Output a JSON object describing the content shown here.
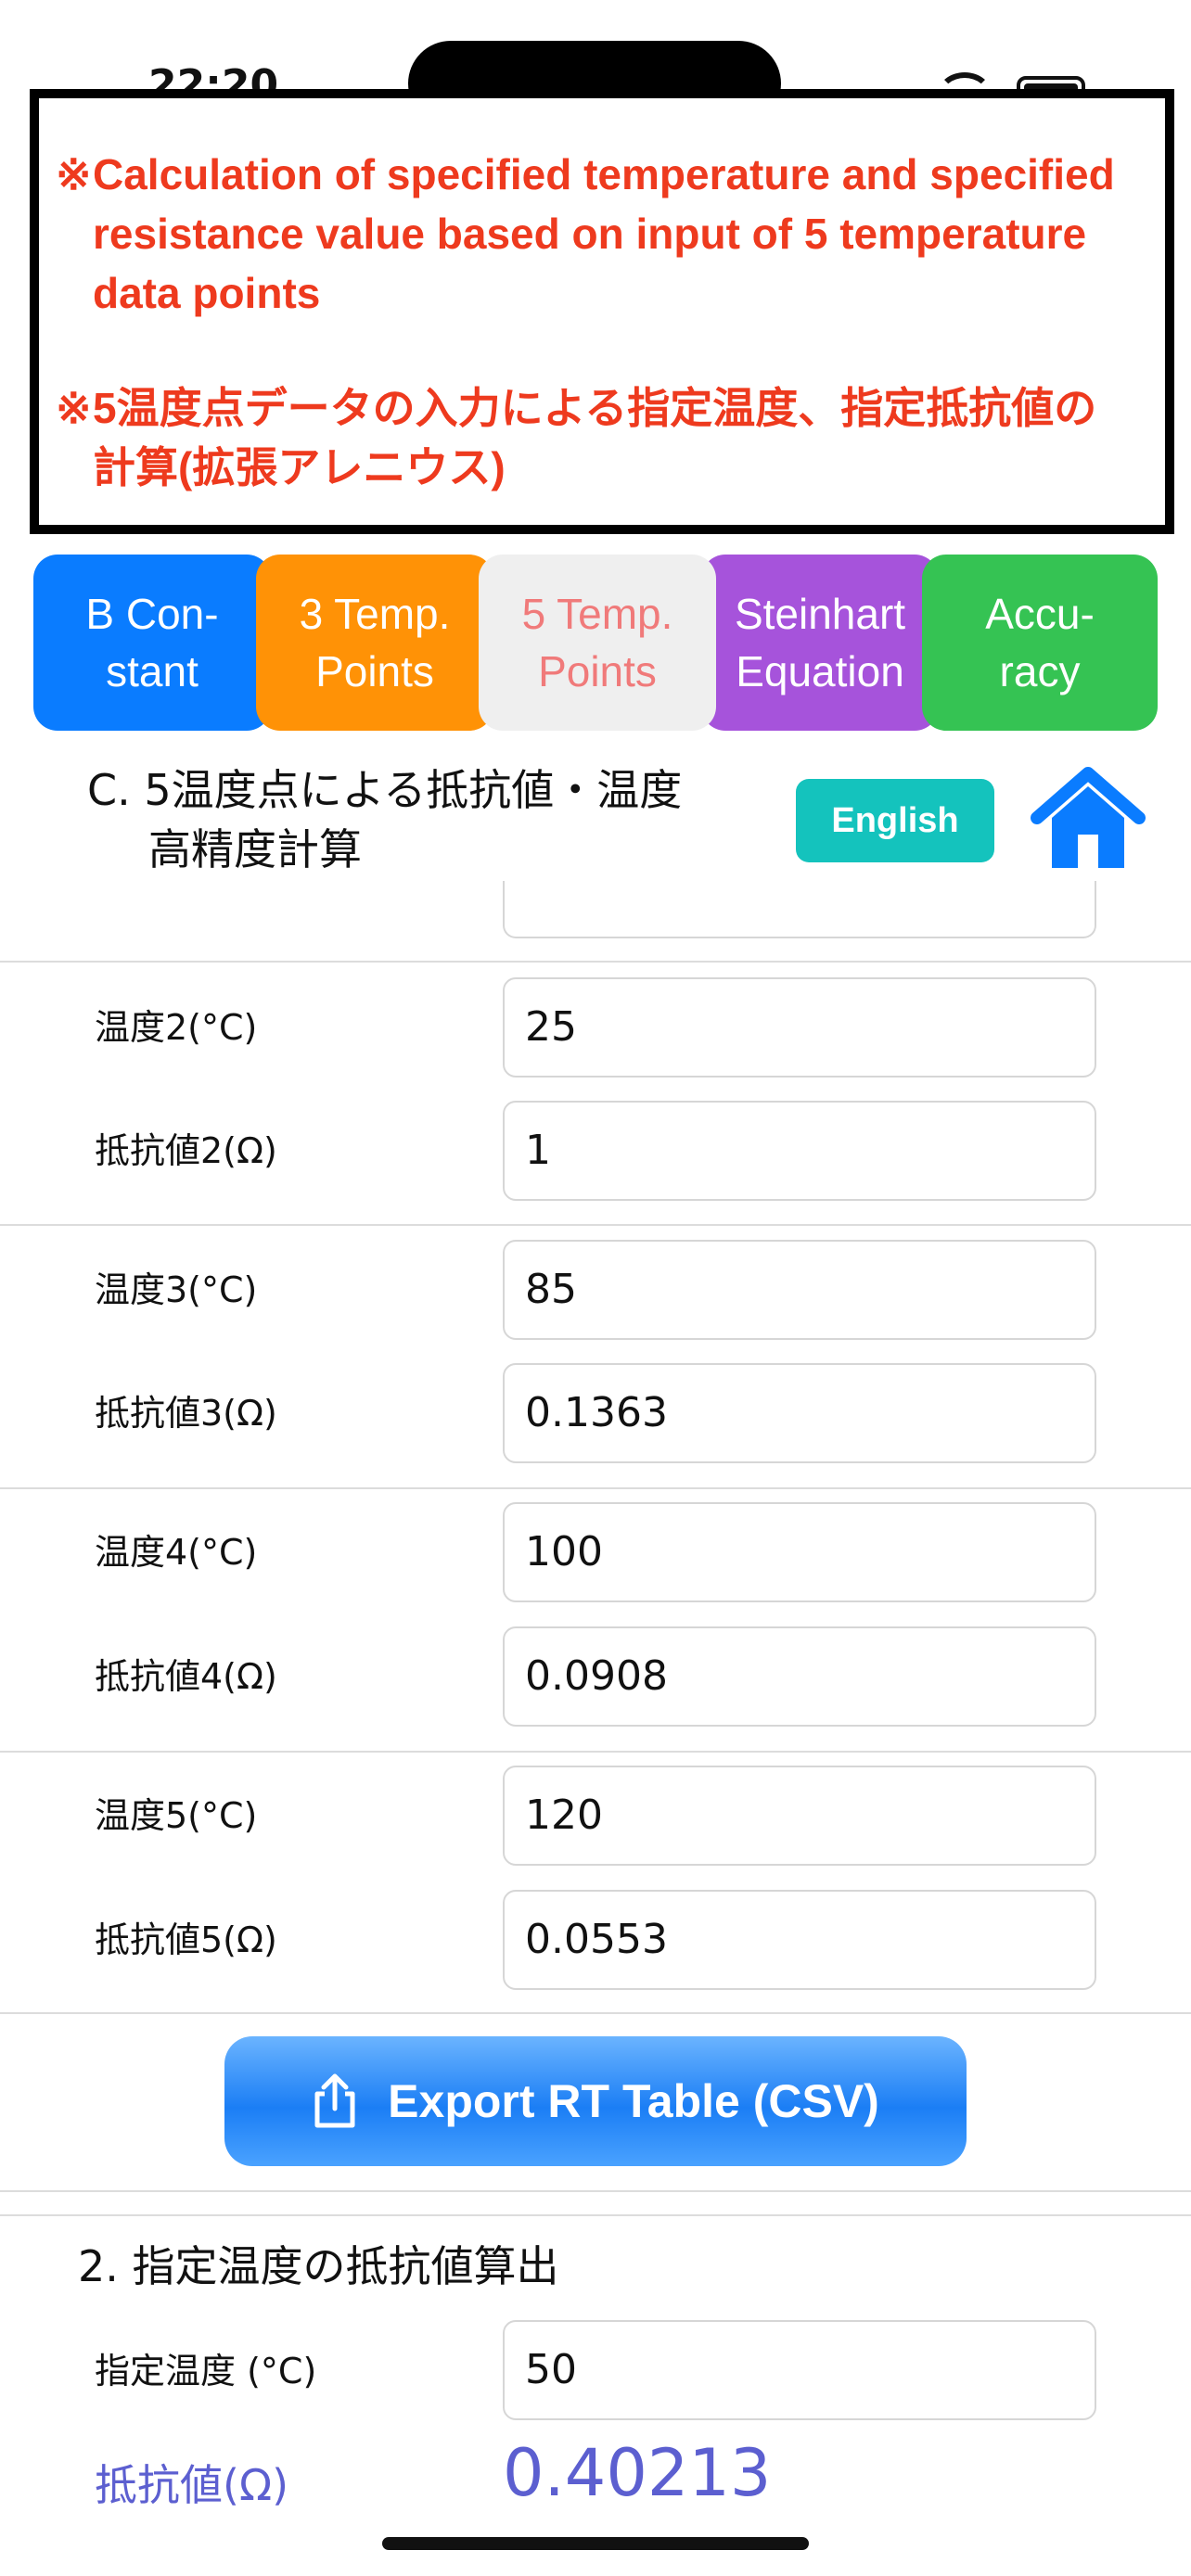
{
  "status_bar": {
    "time": "22:20"
  },
  "notice": {
    "mark": "※",
    "english": "Calculation of specified temperature and specified resistance value based on input of 5 temperature data points",
    "japanese": "5温度点データの入力による指定温度、指定抵抗値の計算(拡張アレニウス)"
  },
  "tabs": [
    {
      "label": "B Con-\nstant",
      "color": "#0a7cff",
      "active": false
    },
    {
      "label": "3 Temp.\nPoints",
      "color": "#ff9206",
      "active": false
    },
    {
      "label": "5 Temp.\nPoints",
      "color": "#efefef",
      "active": true
    },
    {
      "label": "Steinhart\nEquation",
      "color": "#a653db",
      "active": false
    },
    {
      "label": "Accu-\nracy",
      "color": "#35c353",
      "active": false
    }
  ],
  "section_c": {
    "title_line1": "C. 5温度点による抵抗値・温度",
    "title_line2": "高精度計算",
    "language_button": "English",
    "home_icon": "home-icon"
  },
  "fields": [
    {
      "label": "温度2(°C)",
      "value": "25"
    },
    {
      "label": "抵抗値2(Ω)",
      "value": "1"
    },
    {
      "label": "温度3(°C)",
      "value": "85"
    },
    {
      "label": "抵抗値3(Ω)",
      "value": "0.1363"
    },
    {
      "label": "温度4(°C)",
      "value": "100"
    },
    {
      "label": "抵抗値4(Ω)",
      "value": "0.0908"
    },
    {
      "label": "温度5(°C)",
      "value": "120"
    },
    {
      "label": "抵抗値5(Ω)",
      "value": "0.0553"
    }
  ],
  "export_button": {
    "label": "Export RT Table (CSV)",
    "icon": "share-icon"
  },
  "section2": {
    "title": "2.  指定温度の抵抗値算出",
    "temperature_label": "指定温度 (°C)",
    "temperature_value": "50",
    "resistance_label": "抵抗値(Ω)",
    "resistance_value": "0.40213"
  },
  "colors": {
    "notice_text": "#ee3a1e",
    "active_tab_text": "#f07a7a",
    "language_button": "#14c3bd",
    "home_icon": "#0a7cff",
    "result": "#5c5fd0"
  }
}
